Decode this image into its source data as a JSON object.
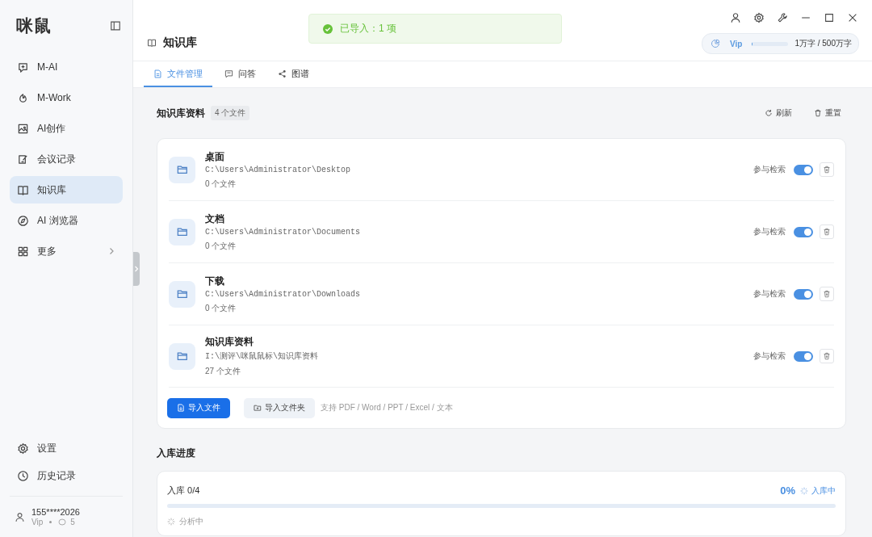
{
  "sidebar": {
    "logo": "咪鼠",
    "items": [
      {
        "label": "M-AI",
        "selected": false,
        "expandable": false
      },
      {
        "label": "M-Work",
        "selected": false,
        "expandable": false
      },
      {
        "label": "AI创作",
        "selected": false,
        "expandable": false
      },
      {
        "label": "会议记录",
        "selected": false,
        "expandable": false
      },
      {
        "label": "知识库",
        "selected": true,
        "expandable": false
      },
      {
        "label": "AI 浏览器",
        "selected": false,
        "expandable": false
      },
      {
        "label": "更多",
        "selected": false,
        "expandable": true
      }
    ],
    "bottom_items": [
      {
        "label": "设置"
      },
      {
        "label": "历史记录"
      }
    ],
    "user": {
      "phone": "155****2026",
      "plan": "Vip",
      "count": "5"
    }
  },
  "toast": {
    "message": "已导入：1 项"
  },
  "header": {
    "title": "知识库",
    "usage": {
      "plan": "Vip",
      "level": 0.002,
      "reading": "1万字 / 500万字"
    }
  },
  "tabs": [
    {
      "label": "文件管理",
      "selected": true
    },
    {
      "label": "问答",
      "selected": false
    },
    {
      "label": "图谱",
      "selected": false
    }
  ],
  "library": {
    "title": "知识库资料",
    "count": "4 个文件",
    "actions": [
      "刷新",
      "重置"
    ],
    "folders": [
      {
        "name": "桌面",
        "path": "C:\\Users\\Administrator\\Desktop",
        "files": "0 个文件",
        "toggle_label": "参与检索",
        "on": true
      },
      {
        "name": "文档",
        "path": "C:\\Users\\Administrator\\Documents",
        "files": "0 个文件",
        "toggle_label": "参与检索",
        "on": true
      },
      {
        "name": "下载",
        "path": "C:\\Users\\Administrator\\Downloads",
        "files": "0 个文件",
        "toggle_label": "参与检索",
        "on": true
      },
      {
        "name": "知识库资料",
        "path": "I:\\测评\\咪鼠鼠标\\知识库资料",
        "files": "27 个文件",
        "toggle_label": "参与检索",
        "on": true
      }
    ],
    "import_file": "导入文件",
    "import_folder": "导入文件夹",
    "hint": "支持 PDF / Word / PPT / Excel / 文本"
  },
  "progress": {
    "title": "入库进度",
    "label": "入库 0/4",
    "percent": "0%",
    "status": "入库中",
    "level": 0,
    "sub_status": "分析中"
  }
}
